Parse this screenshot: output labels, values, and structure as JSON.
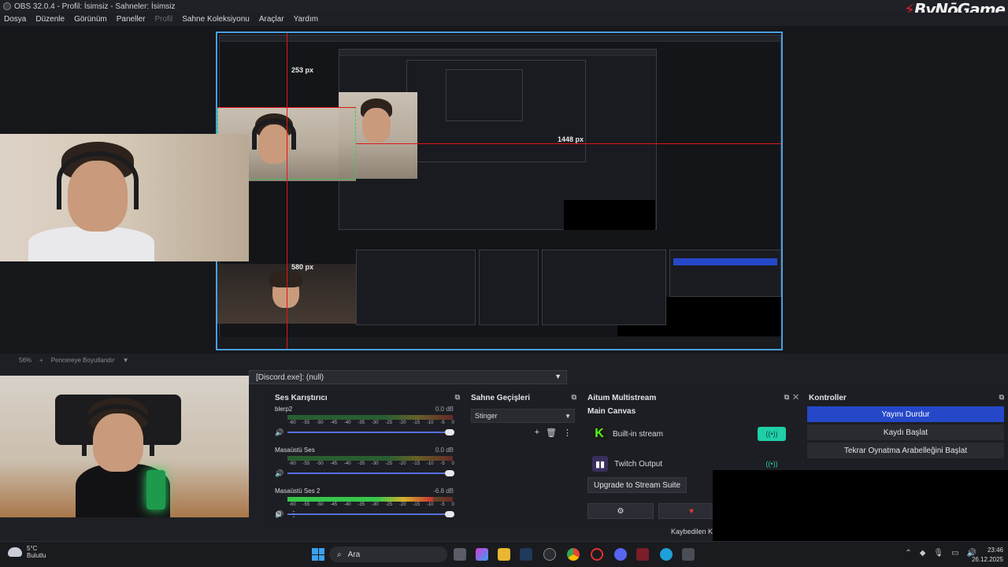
{
  "window": {
    "title": "OBS 32.0.4 - Profil: İsimsiz - Sahneler: İsimsiz",
    "brand_a": "By",
    "brand_b": "NōGame"
  },
  "menu": [
    "Dosya",
    "Düzenle",
    "Görünüm",
    "Paneller",
    "Profil",
    "Sahne Koleksiyonu",
    "Araçlar",
    "Yardım"
  ],
  "preview": {
    "measure_top": "253 px",
    "measure_right": "1448 px",
    "measure_bottom": "580 px"
  },
  "zoombar": {
    "zoom": "56%",
    "plus": "+",
    "fit_label": "Pencereye Boyutlandır"
  },
  "source_select": {
    "value": "[Discord.exe]: (null)"
  },
  "mixer": {
    "title": "Ses Karıştırıcı",
    "ticks": [
      "-60",
      "-55",
      "-50",
      "-45",
      "-40",
      "-35",
      "-30",
      "-25",
      "-20",
      "-15",
      "-10",
      "-5",
      "0"
    ],
    "channels": [
      {
        "name": "blerp2",
        "db": "0.0 dB",
        "level": 0.0
      },
      {
        "name": "Masaüstü Ses",
        "db": "0.0 dB",
        "level": 0.0
      },
      {
        "name": "Masaüstü Ses 2",
        "db": "-6.8 dB",
        "level": 0.88
      }
    ]
  },
  "transitions": {
    "title": "Sahne Geçişleri",
    "selected": "Stinger"
  },
  "aitum": {
    "title": "Aitum Multistream",
    "canvas": "Main Canvas",
    "outputs": [
      {
        "name": "Built-in stream",
        "state": "on"
      },
      {
        "name": "Twitch Output",
        "state": "off"
      }
    ],
    "upgrade_label": "Upgrade to Stream Suite",
    "gear_icon": "gear-icon",
    "heart_icon": "heart-icon"
  },
  "controls": {
    "title": "Kontroller",
    "buttons": [
      "Yayını Durdur",
      "Kaydı Başlat",
      "Tekrar Oynatma Arabelleğini Başlat"
    ]
  },
  "status": {
    "dropped": "Kaybedilen K"
  },
  "taskbar": {
    "temp": "5°C",
    "weather": "Bulutlu",
    "search": "Ara",
    "time": "23:46",
    "date": "26.12.2025"
  },
  "colors": {
    "accent": "#2548c9",
    "preview_border": "#4a9fe0",
    "guide_red": "#e01818",
    "toggle_on": "#1fcfa8",
    "brand_red": "#d61f2c"
  }
}
